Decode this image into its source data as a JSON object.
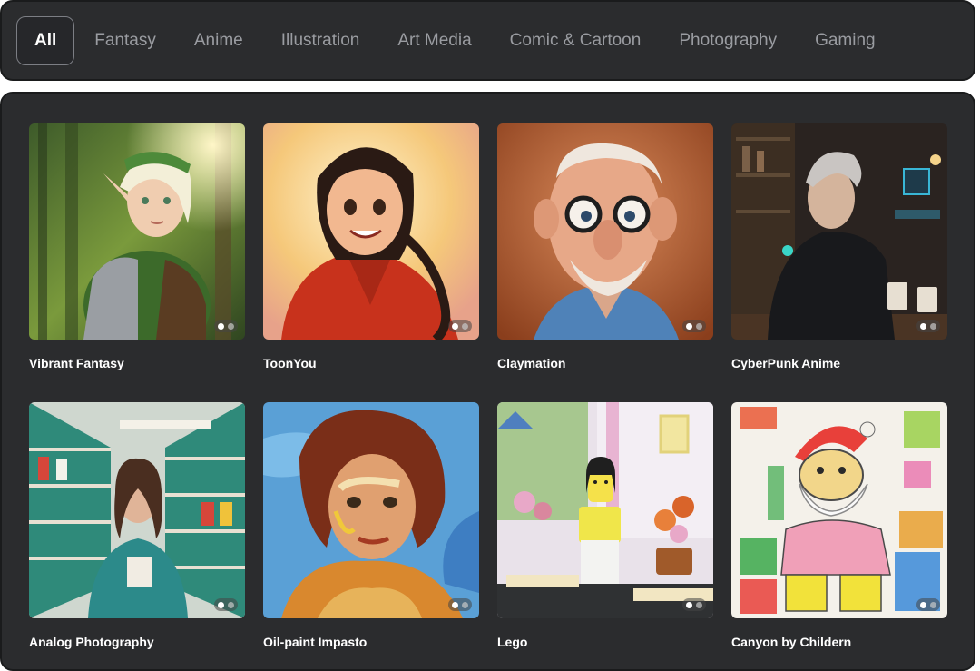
{
  "tabs": [
    {
      "label": "All",
      "active": true
    },
    {
      "label": "Fantasy",
      "active": false
    },
    {
      "label": "Anime",
      "active": false
    },
    {
      "label": "Illustration",
      "active": false
    },
    {
      "label": "Art Media",
      "active": false
    },
    {
      "label": "Comic & Cartoon",
      "active": false
    },
    {
      "label": "Photography",
      "active": false
    },
    {
      "label": "Gaming",
      "active": false
    }
  ],
  "gallery": {
    "cards": [
      {
        "label": "Vibrant Fantasy",
        "image": "elf-warrior-forest-image"
      },
      {
        "label": "ToonYou",
        "image": "cartoon-girl-red-jacket-image"
      },
      {
        "label": "Claymation",
        "image": "clay-old-man-glasses-image"
      },
      {
        "label": "CyberPunk Anime",
        "image": "cyberpunk-man-cafe-image"
      },
      {
        "label": "Analog Photography",
        "image": "woman-in-store-aisle-image"
      },
      {
        "label": "Oil-paint Impasto",
        "image": "impasto-woman-portrait-image"
      },
      {
        "label": "Lego",
        "image": "lego-figure-flowers-image"
      },
      {
        "label": "Canyon by Childern",
        "image": "crayon-santa-drawing-image"
      }
    ]
  },
  "colors": {
    "panel": "#2b2c2e",
    "active_tab_border": "#7c7e84",
    "inactive_tab_text": "#9a9ca1"
  }
}
